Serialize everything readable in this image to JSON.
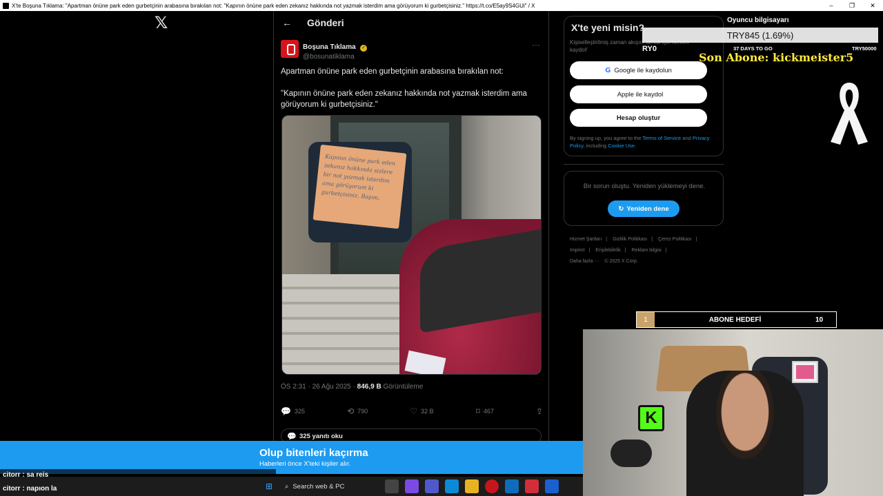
{
  "window": {
    "title": "X'te Boşuna Tıklama: \"Apartman önüne park eden gurbetçinin arabasına bırakılan not: \"Kapının önüne park eden zekanız hakkında not yazmak isterdim ama görüyorum ki gurbetçisiniz.\" https://t.co/E5ay9S4GUi\" / X",
    "minimize": "–",
    "maximize": "❐",
    "close": "✕"
  },
  "x_logo": "𝕏",
  "header": {
    "back": "←",
    "title": "Gönderi"
  },
  "tweet": {
    "author_name": "Boşuna Tıklama",
    "verified_mark": "✓",
    "handle": "@bosunatiklama",
    "more": "···",
    "text_line1": "Apartman önüne park eden gurbetçinin arabasına bırakılan not:",
    "text_line2": "\"Kapının önüne park eden zekanız hakkında not yazmak isterdim ama görüyorum ki gurbetçisiniz.\"",
    "note_handwriting": "Kapının önüne park eden zekanız hakkında sizlere bir not yazmak isterdim ama görüyorum ki gurbetçisiniz. Başım.",
    "time": "ÖS 2:31 · 26 Ağu 2025 · ",
    "views": "846,9 B",
    "views_label": " Görüntüleme",
    "replies": "325",
    "retweets": "790",
    "likes": "32 B",
    "bookmarks": "467",
    "read_replies": "325 yanıtı oku"
  },
  "icons": {
    "reply": "💬",
    "retweet": "⟲",
    "like": "♡",
    "bookmark": "⌑",
    "share": "⇪",
    "google": "G",
    "apple": "",
    "retry": "↻"
  },
  "signup": {
    "title": "X'te yeni misin?",
    "subtitle": "Kişiselleştirilmiş zaman akışını almak için hemen kaydol!",
    "google": "Google ile kaydolun",
    "apple": "Apple ile kaydol",
    "create": "Hesap oluştur",
    "legal_pre": "By signing up, you agree to the ",
    "terms": "Terms of Service",
    "and": " and ",
    "privacy": "Privacy Policy",
    "including": ", including ",
    "cookie": "Cookie Use."
  },
  "error": {
    "text": "Bir sorun oluştu. Yeniden yüklemeyi dene.",
    "retry": "Yeniden dene"
  },
  "footer": {
    "links": [
      "Hizmet Şartları",
      "|",
      "Gizlilik Politikası",
      "|",
      "Çerez Politikası",
      "|"
    ],
    "links2": [
      "Imprint",
      "|",
      "Erişilebilirlik",
      "|",
      "Reklam bilgisi",
      "|"
    ],
    "more": "Daha fazla ···",
    "copyright": "© 2025 X Corp."
  },
  "stream": {
    "player_label": "Oyuncu bilgisayarı",
    "price": "TRY845 (1.69%)",
    "try0": "RY0",
    "days": "37 DAYS TO GO",
    "try50": "TRY50000",
    "son_abone": "Son Abone: kickmeister5",
    "goal_count": "1",
    "goal_label": "ABONE HEDEFİ",
    "goal_target": "10",
    "kick_logo": "K"
  },
  "toast": {
    "title": "Olup bitenleri kaçırma",
    "subtitle": "Haberleri önce X'teki kişiler alır."
  },
  "chat": [
    {
      "user": "citorr",
      "msg": " : sa reis"
    },
    {
      "user": "citorr",
      "msg": " : napıon la"
    }
  ],
  "taskbar": {
    "search": "Search web & PC",
    "start": "⊞",
    "search_icon": "⌕"
  }
}
